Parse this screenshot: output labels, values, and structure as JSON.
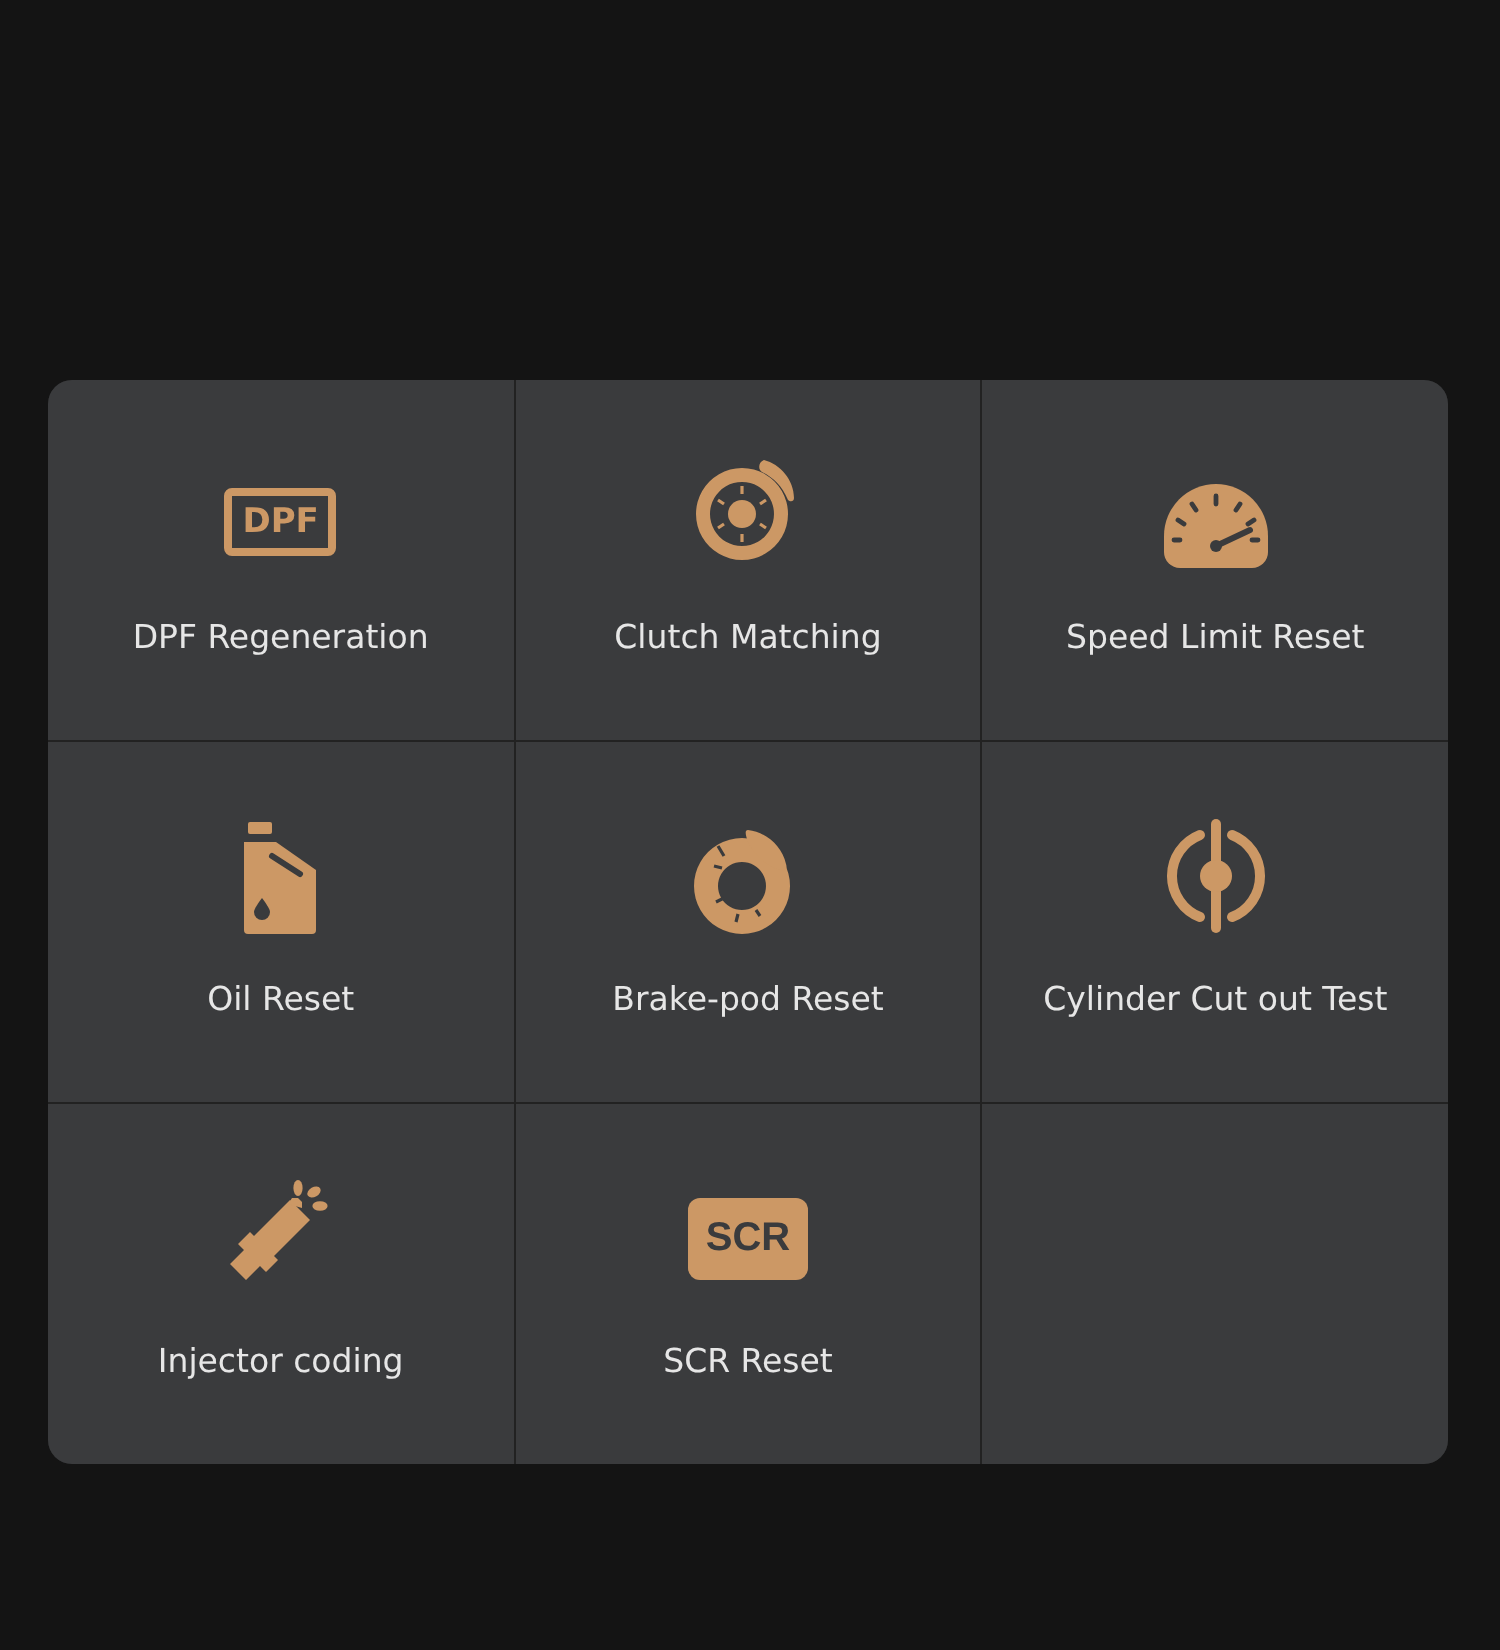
{
  "tools": [
    {
      "kind": "dpf",
      "badge_text": "DPF",
      "label": "DPF Regeneration"
    },
    {
      "kind": "disc",
      "label": "Clutch Matching"
    },
    {
      "kind": "gauge",
      "label": "Speed Limit Reset"
    },
    {
      "kind": "oil",
      "label": "Oil Reset"
    },
    {
      "kind": "brake",
      "label": "Brake-pod Reset"
    },
    {
      "kind": "cylinder",
      "label": "Cylinder Cut out Test"
    },
    {
      "kind": "injector",
      "label": "Injector coding"
    },
    {
      "kind": "scr",
      "badge_text": "SCR",
      "label": "SCR Reset"
    }
  ]
}
